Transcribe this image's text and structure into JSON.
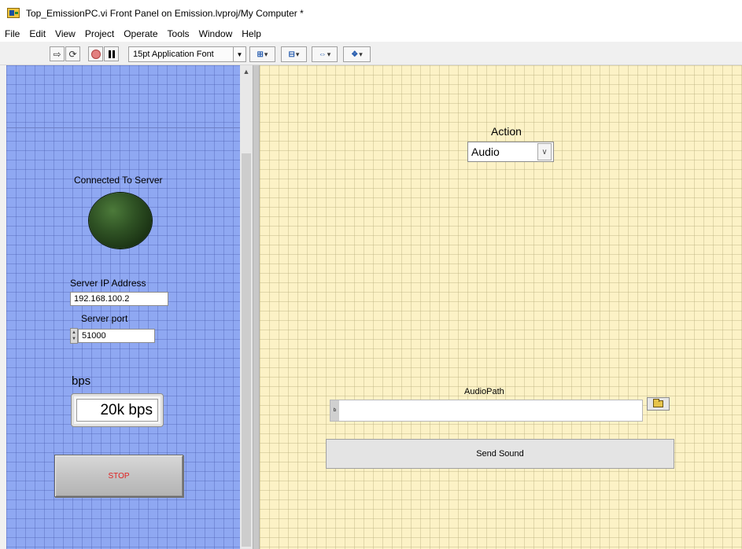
{
  "window": {
    "title": "Top_EmissionPC.vi Front Panel on Emission.lvproj/My Computer *"
  },
  "menu": [
    "File",
    "Edit",
    "View",
    "Project",
    "Operate",
    "Tools",
    "Window",
    "Help"
  ],
  "toolbar": {
    "font": "15pt Application Font",
    "icons": [
      "run-arrow-icon",
      "run-continuously-icon",
      "abort-icon",
      "pause-icon",
      "align-icon",
      "distribute-icon",
      "resize-icon",
      "reorder-icon"
    ]
  },
  "left_panel": {
    "connected_label": "Connected To Server",
    "led_state": "off",
    "ip_label": "Server IP Address",
    "ip_value": "192.168.100.2",
    "port_label": "Server port",
    "port_value": "51000",
    "bps_label": "bps",
    "bps_value": "20k bps",
    "stop_label": "STOP"
  },
  "right_panel": {
    "action_label": "Action",
    "action_value": "Audio",
    "audiopath_label": "AudioPath",
    "audiopath_value": "",
    "send_label": "Send Sound"
  },
  "colors": {
    "left_bg": "#8fa8f2",
    "right_bg": "#fcf2c6",
    "stop_text": "#e02020",
    "led_off": "#2f5224"
  }
}
